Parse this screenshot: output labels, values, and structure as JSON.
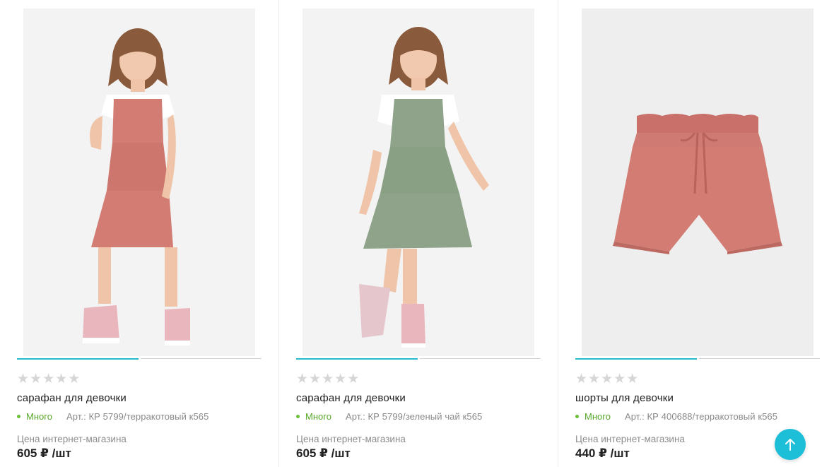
{
  "products": [
    {
      "title": "сарафан для девочки",
      "stock": "Много",
      "article": "Арт.: КР 5799/терракотовый к565",
      "price_label": "Цена интернет-магазина",
      "price": "605 ₽ /шт",
      "rating_stars": [
        "★",
        "★",
        "★",
        "★",
        "★"
      ],
      "image_icon": "girl-in-terracotta-sundress"
    },
    {
      "title": "сарафан для девочки",
      "stock": "Много",
      "article": "Арт.: КР 5799/зеленый чай к565",
      "price_label": "Цена интернет-магазина",
      "price": "605 ₽ /шт",
      "rating_stars": [
        "★",
        "★",
        "★",
        "★",
        "★"
      ],
      "image_icon": "girl-in-green-sundress"
    },
    {
      "title": "шорты для девочки",
      "stock": "Много",
      "article": "Арт.: КР 400688/терракотовый к565",
      "price_label": "Цена интернет-магазина",
      "price": "440 ₽ /шт",
      "rating_stars": [
        "★",
        "★",
        "★",
        "★",
        "★"
      ],
      "image_icon": "terracotta-shorts"
    }
  ],
  "colors": {
    "accent": "#1dbfd8",
    "slider_active": "#29b9cf",
    "in_stock": "#59a82a",
    "terracotta": "#d27c73",
    "sage": "#8fa38a"
  },
  "scroll_up_icon": "arrow-up-icon"
}
